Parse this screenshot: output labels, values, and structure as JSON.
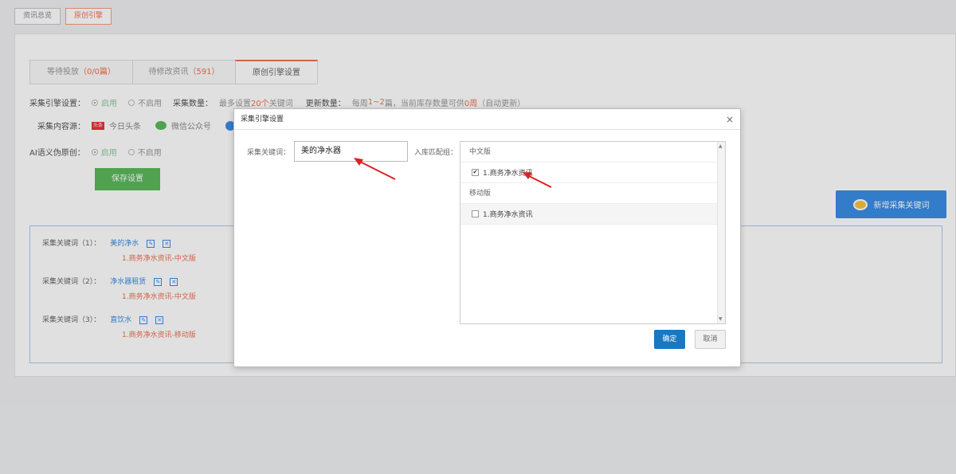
{
  "top_tabs": [
    {
      "label": "资讯总览"
    },
    {
      "label": "原创引擎"
    }
  ],
  "sub_tabs": [
    {
      "label": "等待投放",
      "count": "（0/0篇）"
    },
    {
      "label": "待修改资讯",
      "count": "（591）"
    },
    {
      "label": "原创引擎设置"
    }
  ],
  "engine": {
    "label": "采集引擎设置：",
    "on": "启用",
    "off": "不启用",
    "quantity_label": "采集数量：",
    "quantity_pre": "最多设置",
    "quantity_num": "20个",
    "quantity_post": "关键词",
    "update_label": "更新数量：",
    "update_pre": "每周",
    "update_range": "1~2",
    "update_mid": "篇，当前库存数量可供",
    "update_num": "0周",
    "update_post": "（自动更新）"
  },
  "sources": {
    "label": "采集内容源：",
    "toutiao_badge": "头条",
    "toutiao": "今日头条",
    "wechat": "微信公众号"
  },
  "ai": {
    "label": "AI语义伪原创：",
    "on": "启用",
    "off": "不启用"
  },
  "save_button": "保存设置",
  "new_keyword_button": "新增采集关键词",
  "keywords": [
    {
      "label": "采集关键词（1）：",
      "name": "美的净水",
      "group": "1.商务净水资讯-中文版"
    },
    {
      "label": "采集关键词（2）：",
      "name": "净水器租赁",
      "group": "1.商务净水资讯-中文版"
    },
    {
      "label": "采集关键词（3）：",
      "name": "直饮水",
      "group": "1.商务净水资讯-移动版"
    }
  ],
  "modal": {
    "title": "采集引擎设置",
    "close": "×",
    "keyword_label": "采集关键词：",
    "keyword_value": "美的净水器",
    "group_label": "入库匹配组：",
    "sections": [
      {
        "title": "中文版",
        "options": [
          {
            "label": "1.商务净水资讯",
            "checked": true
          }
        ]
      },
      {
        "title": "移动版",
        "options": [
          {
            "label": "1.商务净水资讯",
            "checked": false
          }
        ]
      }
    ],
    "ok": "确定",
    "cancel": "取消"
  },
  "colors": {
    "accent": "#f07050",
    "primary": "#1a78c2",
    "green": "#5cb85c",
    "blue": "#3a8ee6"
  }
}
